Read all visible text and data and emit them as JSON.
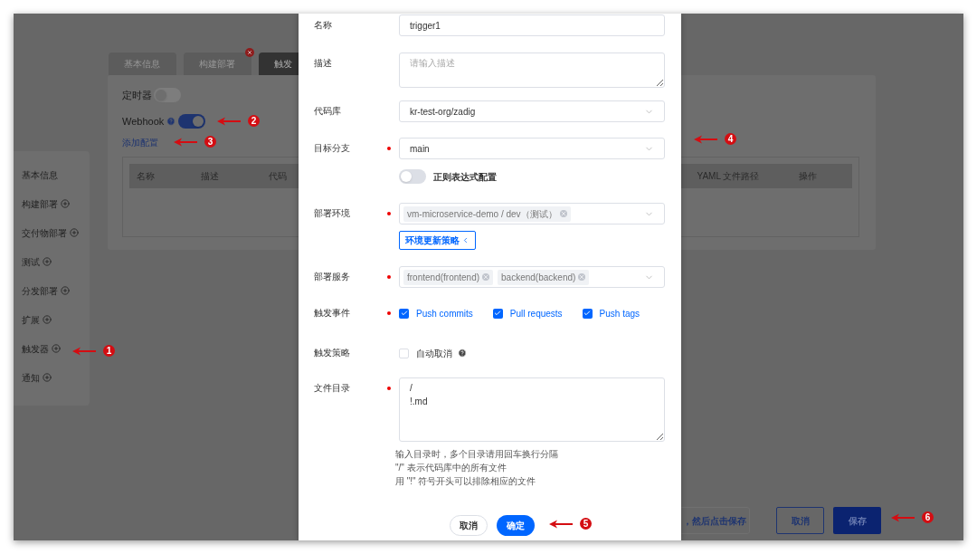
{
  "background_page": {
    "sidebar": [
      {
        "label": "基本信息",
        "addable": false
      },
      {
        "label": "构建部署",
        "addable": true
      },
      {
        "label": "交付物部署",
        "addable": true
      },
      {
        "label": "测试",
        "addable": true
      },
      {
        "label": "分发部署",
        "addable": true
      },
      {
        "label": "扩展",
        "addable": true
      },
      {
        "label": "触发器",
        "addable": true
      },
      {
        "label": "通知",
        "addable": true
      }
    ],
    "tabs": [
      {
        "label": "基本信息",
        "selected": false,
        "badge": false
      },
      {
        "label": "构建部署",
        "selected": false,
        "badge": true
      },
      {
        "label": "触发",
        "selected": true,
        "badge": false
      }
    ],
    "timer": {
      "label": "定时器",
      "on": false
    },
    "webhook": {
      "label": "Webhook",
      "on": true
    },
    "add_config_link": "添加配置",
    "table_columns": [
      "名称",
      "描述",
      "代码",
      "YAML 文件路径",
      "操作"
    ],
    "hint": "，然后点击保存",
    "buttons": [
      {
        "label": "取消",
        "kind": "outline"
      },
      {
        "label": "保存",
        "kind": "primary"
      }
    ]
  },
  "modal": {
    "fields": [
      {
        "label": "名称",
        "required": false,
        "kind": "input",
        "value": "trigger1"
      },
      {
        "label": "描述",
        "required": false,
        "kind": "textarea",
        "placeholder": "请输入描述"
      },
      {
        "label": "代码库",
        "required": false,
        "kind": "select",
        "value": "kr-test-org/zadig"
      },
      {
        "label": "目标分支",
        "required": true,
        "kind": "select",
        "value": "main",
        "switch": {
          "label": "正则表达式配置",
          "on": false
        }
      },
      {
        "label": "部署环境",
        "required": true,
        "kind": "tags",
        "tags": [
          "vm-microservice-demo / dev（测试）"
        ],
        "button": "环境更新策略"
      },
      {
        "label": "部署服务",
        "required": true,
        "kind": "tags",
        "tags": [
          "frontend(frontend)",
          "backend(backend)"
        ]
      },
      {
        "label": "触发事件",
        "required": true,
        "kind": "checkboxes",
        "options": [
          {
            "label": "Push commits",
            "checked": true
          },
          {
            "label": "Pull requests",
            "checked": true
          },
          {
            "label": "Push tags",
            "checked": true
          }
        ]
      },
      {
        "label": "触发策略",
        "required": false,
        "kind": "checkboxes",
        "options": [
          {
            "label": "自动取消",
            "checked": false,
            "help": true
          }
        ]
      },
      {
        "label": "文件目录",
        "required": true,
        "kind": "textarea",
        "value": "/\n!.md",
        "help_lines": [
          "输入目录时，多个目录请用回车换行分隔",
          "\"/\" 表示代码库中的所有文件",
          "用 \"!\" 符号开头可以排除相应的文件"
        ]
      }
    ],
    "buttons": [
      {
        "label": "取消",
        "kind": "outline"
      },
      {
        "label": "确定",
        "kind": "primary"
      }
    ]
  },
  "annotations": [
    "1",
    "2",
    "3",
    "4",
    "5",
    "6"
  ]
}
